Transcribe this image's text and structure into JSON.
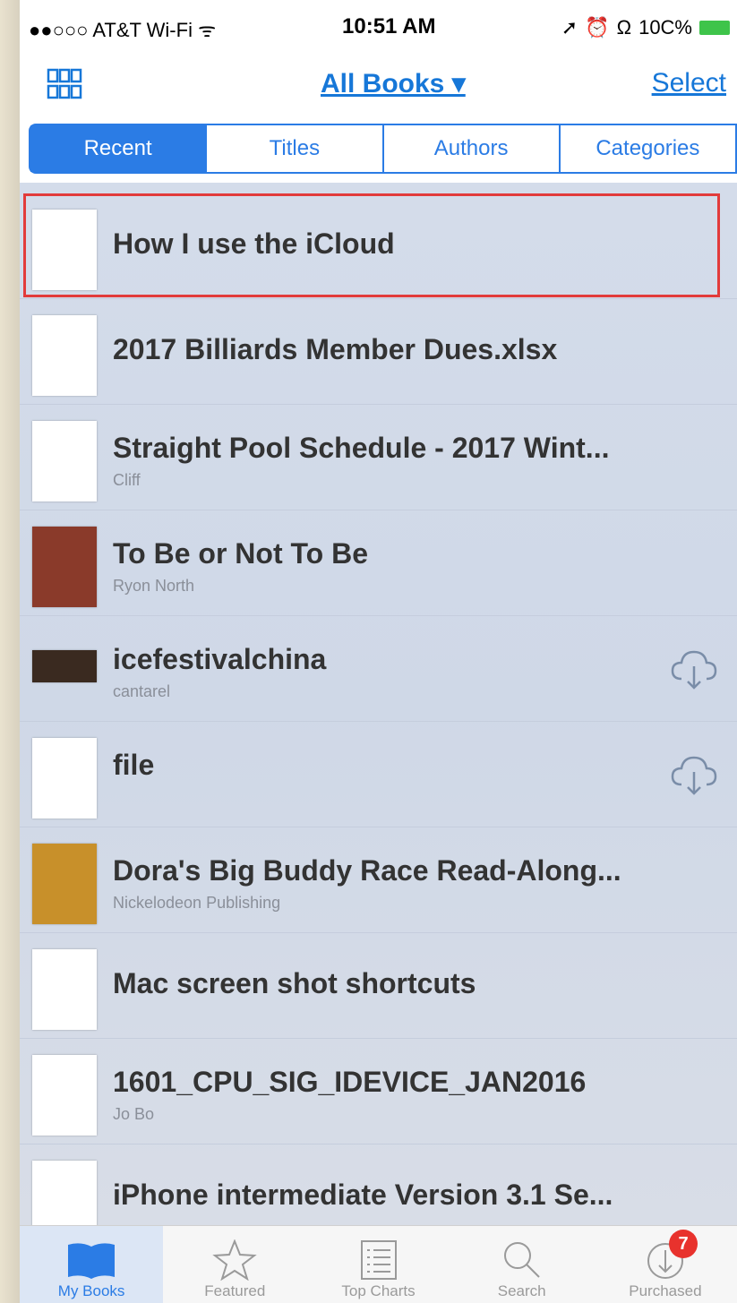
{
  "status_bar": {
    "carrier": "●●○○○ AT&T Wi-Fi ᯤ",
    "time": "10:51 AM",
    "battery_text": "10C%"
  },
  "nav": {
    "title": "All Books ▾",
    "select_label": "Select"
  },
  "segments": [
    "Recent",
    "Titles",
    "Authors",
    "Categories"
  ],
  "books": [
    {
      "title": "How I use the iCloud",
      "author": "",
      "cloud": false
    },
    {
      "title": "2017 Billiards Member Dues.xlsx",
      "author": "",
      "cloud": false
    },
    {
      "title": "Straight Pool Schedule - 2017 Wint...",
      "author": "Cliff",
      "cloud": false
    },
    {
      "title": "To Be or Not To Be",
      "author": "Ryon North",
      "cloud": false
    },
    {
      "title": "icefestivalchina",
      "author": "cantarel",
      "cloud": true
    },
    {
      "title": "file",
      "author": "",
      "cloud": true
    },
    {
      "title": "Dora's Big Buddy Race Read-Along...",
      "author": "Nickelodeon Publishing",
      "cloud": false
    },
    {
      "title": "Mac screen shot shortcuts",
      "author": "",
      "cloud": false
    },
    {
      "title": "1601_CPU_SIG_IDEVICE_JAN2016",
      "author": "Jo Bo",
      "cloud": false
    },
    {
      "title": "iPhone intermediate Version 3.1 Se...",
      "author": "",
      "cloud": false
    }
  ],
  "tabs": [
    {
      "label": "My Books",
      "icon": "book-icon"
    },
    {
      "label": "Featured",
      "icon": "star-icon"
    },
    {
      "label": "Top Charts",
      "icon": "list-icon"
    },
    {
      "label": "Search",
      "icon": "search-icon"
    },
    {
      "label": "Purchased",
      "icon": "purchased-icon",
      "badge": "7"
    }
  ],
  "colors": {
    "accent": "#2b7ce5",
    "highlight": "#e23b3b",
    "badge": "#e8322d"
  }
}
